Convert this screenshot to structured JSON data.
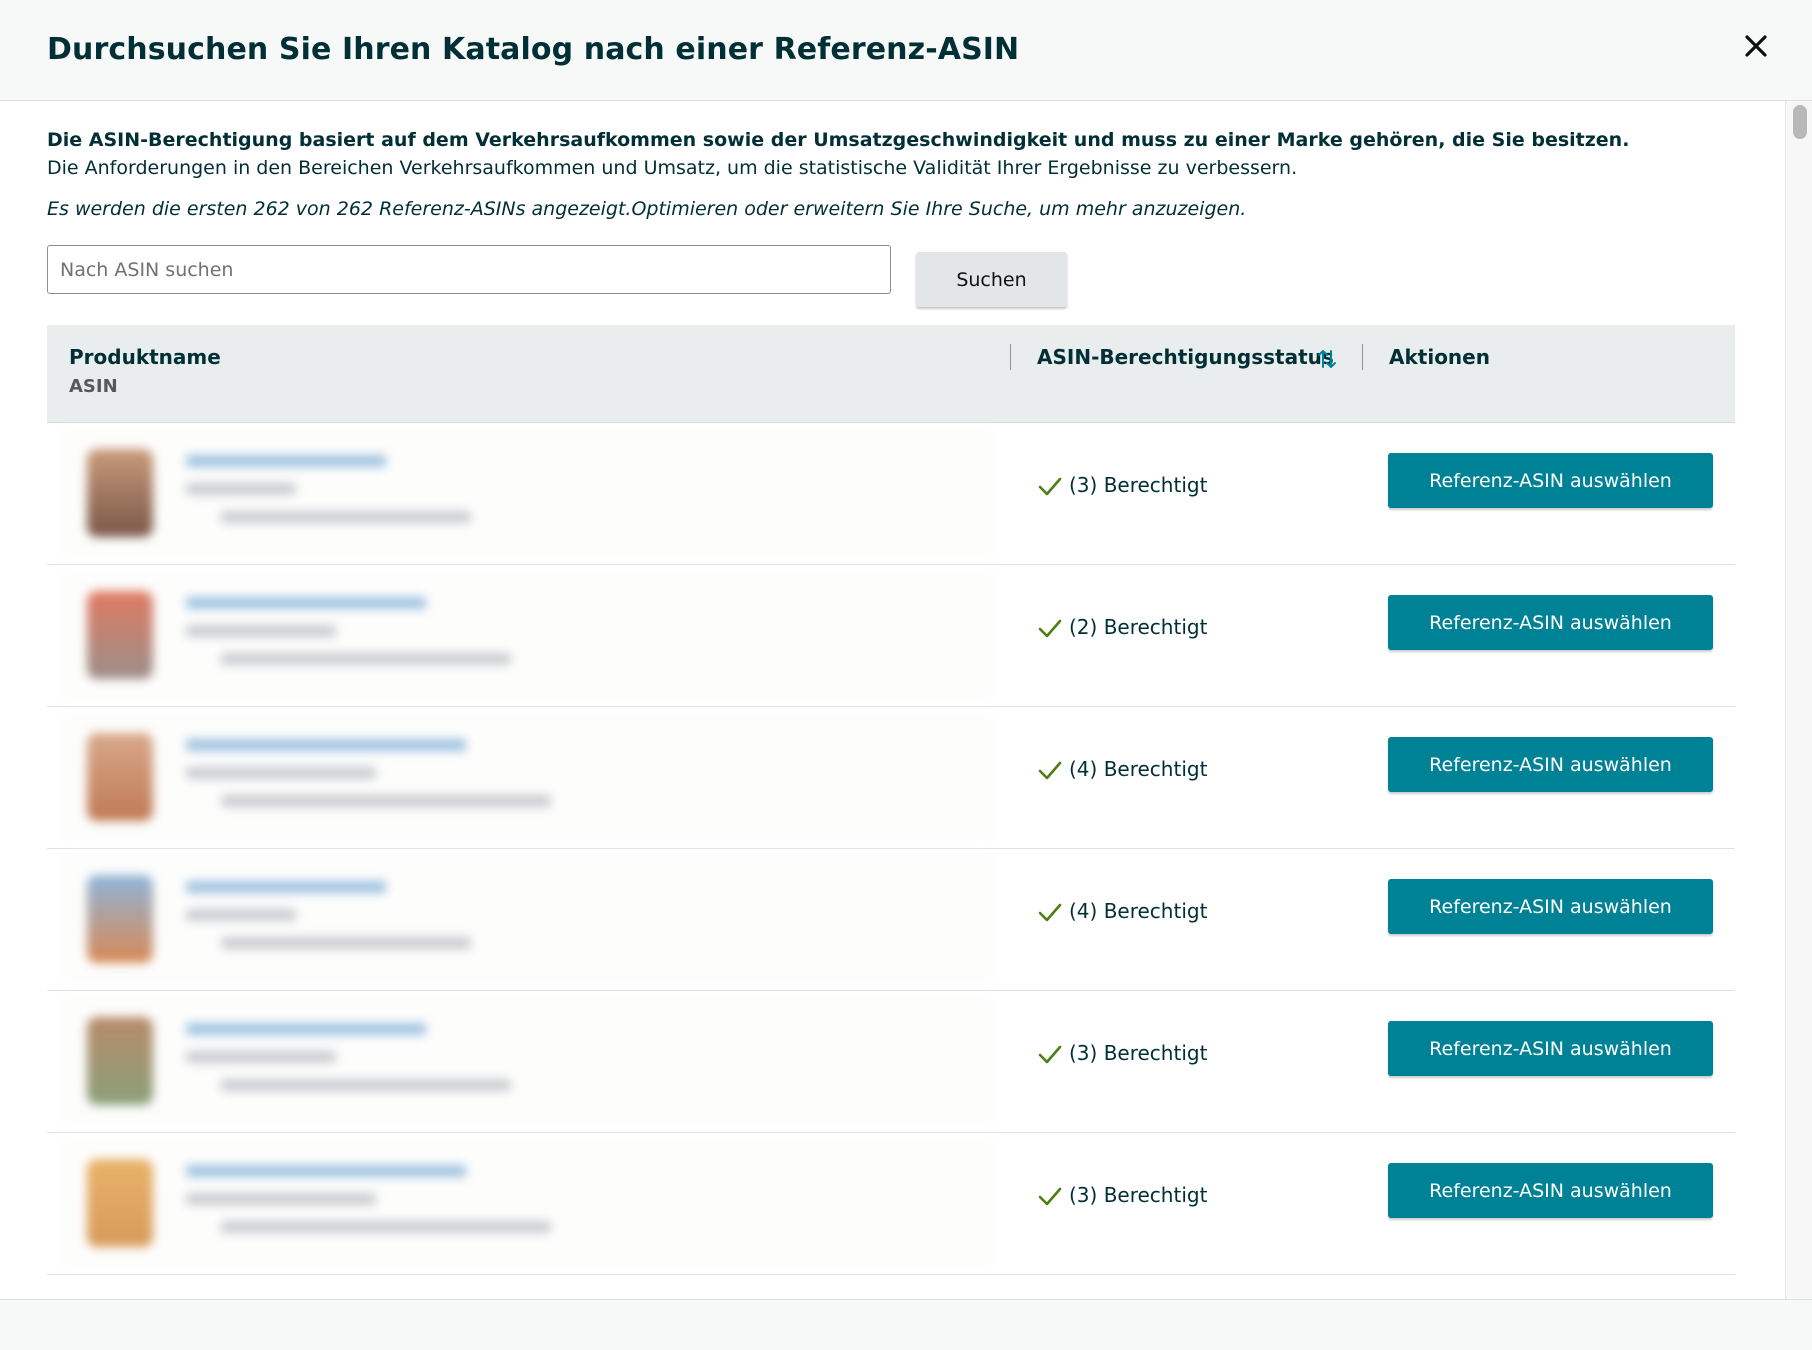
{
  "modal": {
    "title": "Durchsuchen Sie Ihren Katalog nach einer Referenz-ASIN",
    "close_icon": "close-icon"
  },
  "info": {
    "bold": "Die ASIN-Berechtigung basiert auf dem Verkehrsaufkommen sowie der Umsatzgeschwindigkeit und muss zu einer Marke gehören, die Sie besitzen.",
    "text": "Die Anforderungen in den Bereichen Verkehrsaufkommen und Umsatz, um die statistische Validität Ihrer Ergebnisse zu verbessern.",
    "italic": "Es werden die ersten 262 von 262 Referenz-ASINs angezeigt.Optimieren oder erweitern Sie Ihre Suche, um mehr anzuzeigen."
  },
  "search": {
    "placeholder": "Nach ASIN suchen",
    "value": "",
    "button": "Suchen"
  },
  "table": {
    "header": {
      "product": "Produktname",
      "asin": "ASIN",
      "status": "ASIN-Berechtigungsstatus",
      "actions": "Aktionen",
      "sort_icon": "sort-icon"
    },
    "rows": [
      {
        "status": "(3) Berechtigt",
        "action": "Referenz-ASIN auswählen",
        "thumb_colors": [
          "#c89a7a",
          "#7a5748"
        ]
      },
      {
        "status": "(2) Berechtigt",
        "action": "Referenz-ASIN auswählen",
        "thumb_colors": [
          "#e07a62",
          "#9b8f8a"
        ]
      },
      {
        "status": "(4) Berechtigt",
        "action": "Referenz-ASIN auswählen",
        "thumb_colors": [
          "#d8a88a",
          "#c07a55"
        ]
      },
      {
        "status": "(4) Berechtigt",
        "action": "Referenz-ASIN auswählen",
        "thumb_colors": [
          "#8fb4d8",
          "#d78a55"
        ]
      },
      {
        "status": "(3) Berechtigt",
        "action": "Referenz-ASIN auswählen",
        "thumb_colors": [
          "#b88a6a",
          "#8aa07a"
        ]
      },
      {
        "status": "(3) Berechtigt",
        "action": "Referenz-ASIN auswählen",
        "thumb_colors": [
          "#e8b26a",
          "#d89a5a"
        ]
      }
    ]
  },
  "colors": {
    "accent": "#008296",
    "check": "#4e7e10",
    "title": "#002f36"
  }
}
